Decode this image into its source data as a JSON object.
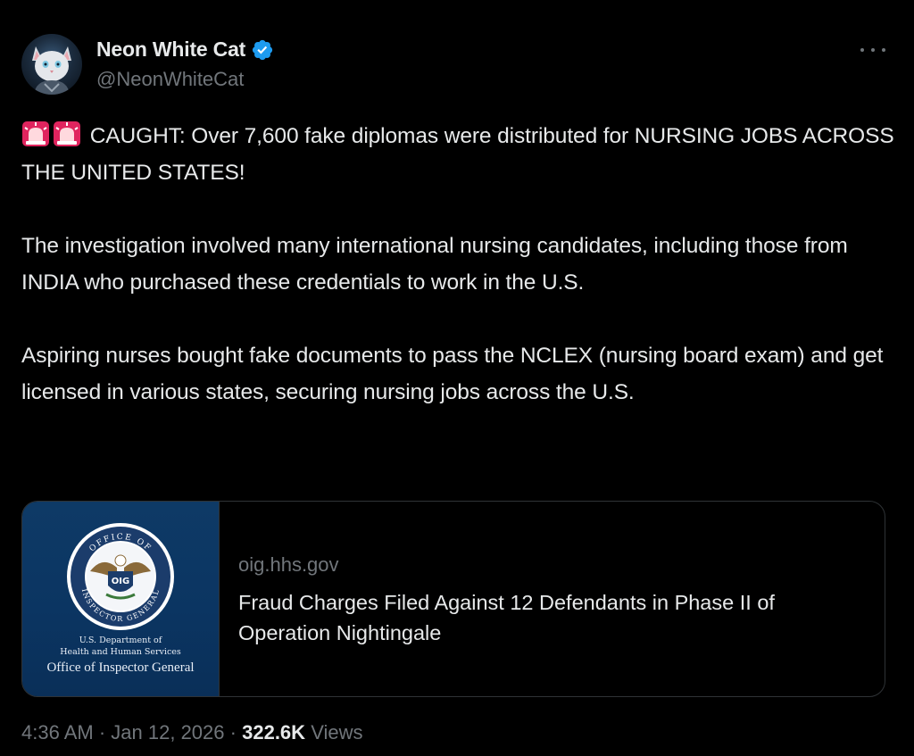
{
  "author": {
    "display_name": "Neon White Cat",
    "handle": "@NeonWhiteCat",
    "verified_icon": "verified-badge-icon",
    "verified_color": "#1d9bf0"
  },
  "tweet": {
    "paragraphs": [
      {
        "prefix_icons": [
          "siren-icon",
          "siren-icon"
        ],
        "text": "CAUGHT: Over 7,600 fake diplomas were distributed for NURSING JOBS ACROSS THE UNITED STATES!"
      },
      {
        "text": "The investigation involved many international nursing candidates, including those from INDIA who purchased these credentials to work in the U.S."
      },
      {
        "text": "Aspiring nurses bought fake documents to pass the NCLEX (nursing board exam) and get licensed in various states, securing nursing jobs across the U.S."
      }
    ]
  },
  "link_card": {
    "domain": "oig.hhs.gov",
    "title": "Fraud Charges Filed Against 12 Defendants in Phase II of Operation Nightingale",
    "image": {
      "seal_top_text": "OFFICE OF",
      "seal_side_text": "INSPECTOR GENERAL",
      "seal_badge": "OIG",
      "dept_line1": "U.S. Department of",
      "dept_line2": "Health and Human Services",
      "dept_line3": "Office of Inspector General",
      "background_color": "#0b3562"
    }
  },
  "footer": {
    "time": "4:36 AM",
    "separator": "·",
    "date": "Jan 12, 2026",
    "views_count": "322.6K",
    "views_label": "Views"
  },
  "colors": {
    "background": "#000000",
    "text_primary": "#e7e9ea",
    "text_secondary": "#71767b",
    "border": "#2f3336",
    "siren_red": "#e0245e"
  }
}
